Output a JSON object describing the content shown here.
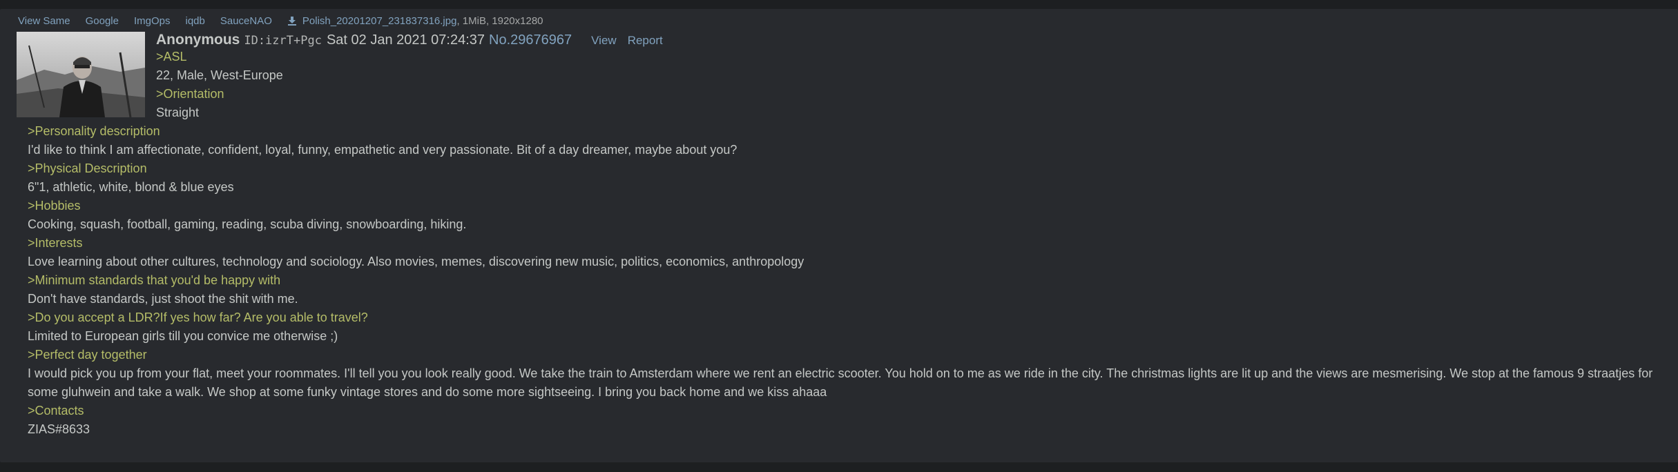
{
  "file_bar": {
    "links": [
      "View Same",
      "Google",
      "ImgOps",
      "iqdb",
      "SauceNAO"
    ],
    "download_icon": "download-icon",
    "filename": "Polish_20201207_231837316.jpg",
    "meta": ", 1MiB, 1920x1280"
  },
  "header": {
    "name": "Anonymous",
    "poster_id": "ID:izrT+Pgc",
    "date": "Sat 02 Jan 2021 07:24:37",
    "post_number": "No.29676967",
    "view_label": "View",
    "report_label": "Report"
  },
  "body_lines": [
    {
      "text": ">ASL",
      "quote": true
    },
    {
      "text": "22, Male, West-Europe",
      "quote": false
    },
    {
      "text": ">Orientation",
      "quote": true
    },
    {
      "text": "Straight",
      "quote": false
    },
    {
      "text": ">Personality description",
      "quote": true
    },
    {
      "text": "I'd like to think I am affectionate, confident, loyal, funny, empathetic and very passionate. Bit of a day dreamer, maybe about you?",
      "quote": false
    },
    {
      "text": ">Physical Description",
      "quote": true
    },
    {
      "text": "6\"1, athletic, white, blond & blue eyes",
      "quote": false
    },
    {
      "text": ">Hobbies",
      "quote": true
    },
    {
      "text": "Cooking, squash, football, gaming, reading, scuba diving, snowboarding, hiking.",
      "quote": false
    },
    {
      "text": ">Interests",
      "quote": true
    },
    {
      "text": "Love learning about other cultures, technology and sociology. Also movies, memes, discovering new music, politics, economics, anthropology",
      "quote": false
    },
    {
      "text": ">Minimum standards that you'd be happy with",
      "quote": true
    },
    {
      "text": "Don't have standards, just shoot the shit with me.",
      "quote": false
    },
    {
      "text": ">Do you accept a LDR?If yes how far? Are you able to travel?",
      "quote": true
    },
    {
      "text": "Limited to European girls till you convice me otherwise ;)",
      "quote": false
    },
    {
      "text": ">Perfect day together",
      "quote": true
    },
    {
      "text": "I would pick you up from your flat, meet your roommates. I'll tell you you look really good. We take the train to Amsterdam where we rent an electric scooter. You hold on to me as we ride in the city. The christmas lights are lit up and the views are mesmerising. We stop at the famous 9 straatjes for some gluhwein and take a walk. We shop at some funky vintage stores and do some more sightseeing. I bring you back home and we kiss ahaaa",
      "quote": false
    },
    {
      "text": ">Contacts",
      "quote": true
    },
    {
      "text": "ZIAS#8633",
      "quote": false
    }
  ],
  "colors": {
    "background": "#1d1f21",
    "post_background": "#282a2e",
    "text": "#c5c8c6",
    "link": "#81a2be",
    "greentext": "#b5bd68"
  }
}
